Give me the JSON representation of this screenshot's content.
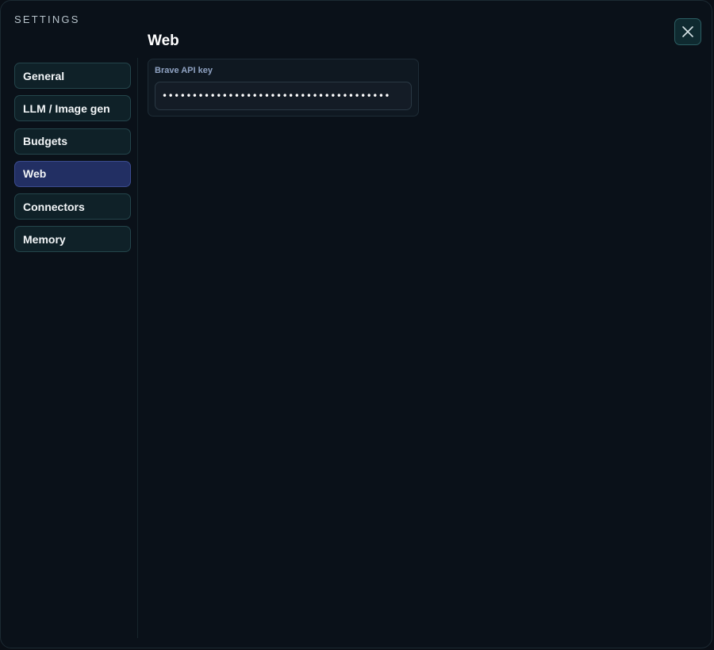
{
  "dialog": {
    "title": "SETTINGS",
    "close_icon": "close-icon"
  },
  "nav": {
    "items": [
      {
        "label": "General",
        "active": false
      },
      {
        "label": "LLM / Image gen",
        "active": false
      },
      {
        "label": "Budgets",
        "active": false
      },
      {
        "label": "Web",
        "active": true
      },
      {
        "label": "Connectors",
        "active": false
      },
      {
        "label": "Memory",
        "active": false
      }
    ]
  },
  "section": {
    "title": "Web",
    "fields": [
      {
        "label": "Brave API key",
        "value": "••••••••••••••••••••••••••••••••••••••",
        "type": "password"
      }
    ]
  },
  "colors": {
    "background": "#0a1119",
    "nav_item": "#0f2128",
    "nav_item_active": "#222f63",
    "close_button": "#0f2a30"
  }
}
